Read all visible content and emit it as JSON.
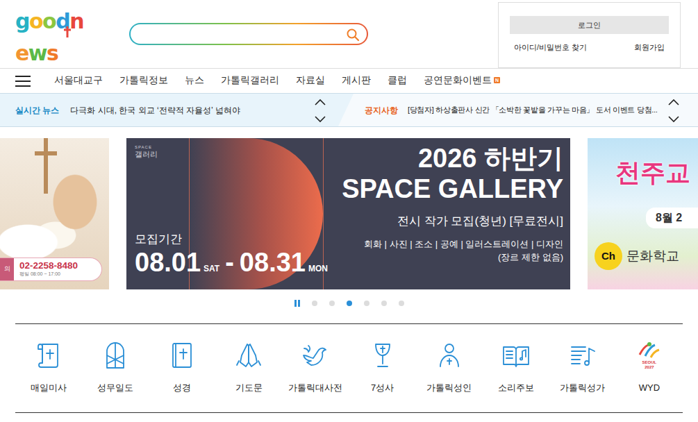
{
  "logo": {
    "text": "goodnews"
  },
  "account": {
    "login": "로그인",
    "find": "아이디/비밀번호 찾기",
    "join": "회원가입"
  },
  "nav": [
    {
      "label": "서울대교구"
    },
    {
      "label": "가톨릭정보"
    },
    {
      "label": "뉴스"
    },
    {
      "label": "가톨릭갤러리"
    },
    {
      "label": "자료실"
    },
    {
      "label": "게시판"
    },
    {
      "label": "클럽"
    },
    {
      "label": "공연문화이벤트",
      "badge": "N"
    }
  ],
  "ticker": {
    "news": {
      "label": "실시간 뉴스",
      "text": "다극화 시대, 한국 외교 ‘전략적 자율성’ 넓혀야"
    },
    "notice": {
      "label": "공지사항",
      "text": "[당첨자] 하상출판사 신간 「소박한 꽃밭을 가꾸는 마음」 도서 이벤트 당첨..."
    }
  },
  "carousel": {
    "playing": true,
    "dots": [
      {
        "selected": false
      },
      {
        "selected": false
      },
      {
        "selected": true
      },
      {
        "selected": false
      },
      {
        "selected": false
      },
      {
        "selected": false
      }
    ],
    "slides": [
      {
        "kind": "contact",
        "label": "의",
        "phone": "02-2258-8480",
        "hours": "평일 08:00 ~ 17:00"
      },
      {
        "kind": "gallery",
        "brand_top": "SPACE",
        "brand": "갤러리",
        "title": "2026 하반기",
        "title2": "SPACE GALLERY",
        "subtitle": "전시 작가 모집(청년) [무료전시]",
        "genres": "회화 | 사진 | 조소 | 공예 | 일러스트레이션 | 디자인",
        "note": "(장르 제한 없음)",
        "period_label": "모집기간",
        "start": "08.01",
        "start_day": "SAT",
        "dash": "-",
        "end": "08.31",
        "end_day": "MON"
      },
      {
        "kind": "event",
        "title": "천주교",
        "date": "8월 2",
        "channel": "Ch",
        "school": "문화학교"
      }
    ]
  },
  "quick_menu": [
    {
      "label": "매일미사",
      "kind": "missal"
    },
    {
      "label": "성무일도",
      "kind": "breviary"
    },
    {
      "label": "성경",
      "kind": "bible"
    },
    {
      "label": "기도문",
      "kind": "prayer"
    },
    {
      "label": "가톨릭대사전",
      "kind": "dictionary"
    },
    {
      "label": "7성사",
      "kind": "sacraments"
    },
    {
      "label": "가톨릭성인",
      "kind": "saints"
    },
    {
      "label": "소리주보",
      "kind": "bulletin"
    },
    {
      "label": "가톨릭성가",
      "kind": "hymn"
    },
    {
      "label": "WYD",
      "kind": "wyd",
      "logo_lines": [
        "SEOUL",
        "2027"
      ]
    }
  ]
}
